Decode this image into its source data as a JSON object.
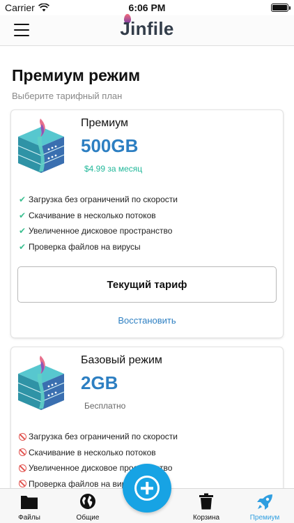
{
  "status_bar": {
    "carrier": "Carrier",
    "time": "6:06 PM"
  },
  "navbar": {
    "logo_text": "Jinfile"
  },
  "page": {
    "title": "Премиум режим",
    "subtitle": "Выберите тарифный план"
  },
  "plans": [
    {
      "name": "Премиум",
      "size": "500GB",
      "price": "$4.99 за месяц",
      "features": [
        "Загрузка без ограничений по скорости",
        "Скачивание в несколько потоков",
        "Увеличенное дисковое пространство",
        "Проверка файлов на вирусы"
      ],
      "feature_icon": "check-icon",
      "button_label": "Текущий тариф",
      "restore_label": "Восстановить"
    },
    {
      "name": "Базовый режим",
      "size": "2GB",
      "price": "Бесплатно",
      "features": [
        "Загрузка без ограничений по скорости",
        "Скачивание в несколько потоков",
        "Увеличенное дисковое пространство",
        "Проверка файлов на вирусы"
      ],
      "feature_icon": "ban-icon"
    }
  ],
  "tabbar": {
    "tabs": [
      {
        "label": "Файлы",
        "icon": "folder-icon"
      },
      {
        "label": "Общие",
        "icon": "globe-icon"
      },
      {
        "label": "Корзина",
        "icon": "trash-icon"
      },
      {
        "label": "Премиум",
        "icon": "rocket-icon",
        "active": true
      }
    ],
    "fab_icon": "plus-circle-icon"
  },
  "colors": {
    "accent": "#2d7fc2",
    "price_green": "#22b89a",
    "check_green": "#3bbf90",
    "ban_red": "#e2534f",
    "fab_blue": "#17a3e4",
    "active_tab": "#2f9ee0"
  }
}
